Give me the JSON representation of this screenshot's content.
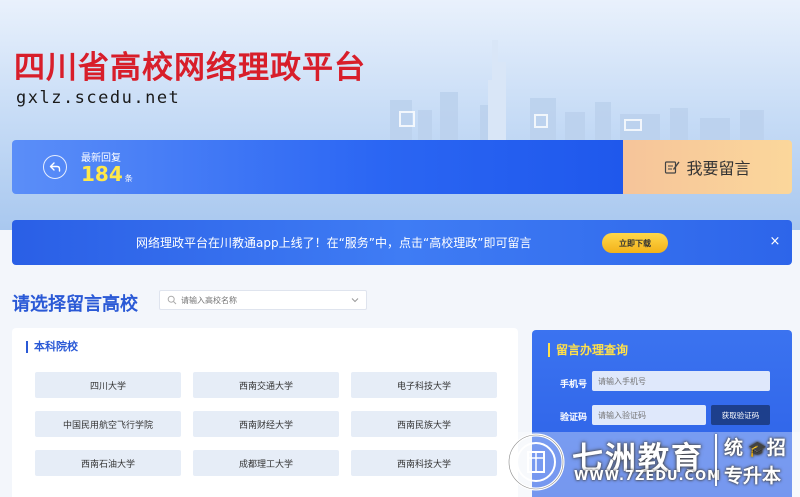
{
  "header": {
    "title": "四川省高校网络理政平台",
    "url": "gxlz.scedu.net"
  },
  "stats": {
    "reply_label": "最新回复",
    "reply_count": "184",
    "reply_unit": "条",
    "leave_message_label": "我要留言"
  },
  "notice": {
    "text": "网络理政平台在川教通app上线了！在“服务”中，点击“高校理政”即可留言",
    "download_label": "立即下载",
    "close_label": "×"
  },
  "select": {
    "title": "请选择留言高校",
    "search_placeholder": "请输入高校名称"
  },
  "schools": {
    "section_title": "本科院校",
    "items": [
      "四川大学",
      "西南交通大学",
      "电子科技大学",
      "中国民用航空飞行学院",
      "西南财经大学",
      "西南民族大学",
      "西南石油大学",
      "成都理工大学",
      "西南科技大学"
    ]
  },
  "query": {
    "title": "留言办理查询",
    "phone_label": "手机号",
    "phone_placeholder": "请输入手机号",
    "code_label": "验证码",
    "code_placeholder": "请输入验证码",
    "get_code_label": "获取验证码"
  },
  "watermark": {
    "brand": "七洲教育",
    "url": "WWW.7ZEDU.COM",
    "side_top": "统",
    "side_top_2": "招",
    "side_bottom": "专升本"
  },
  "colors": {
    "brand_red": "#d81e2a",
    "primary_blue": "#2b66f3",
    "accent_yellow": "#ffe84a",
    "card_bg": "#e6edf7"
  }
}
